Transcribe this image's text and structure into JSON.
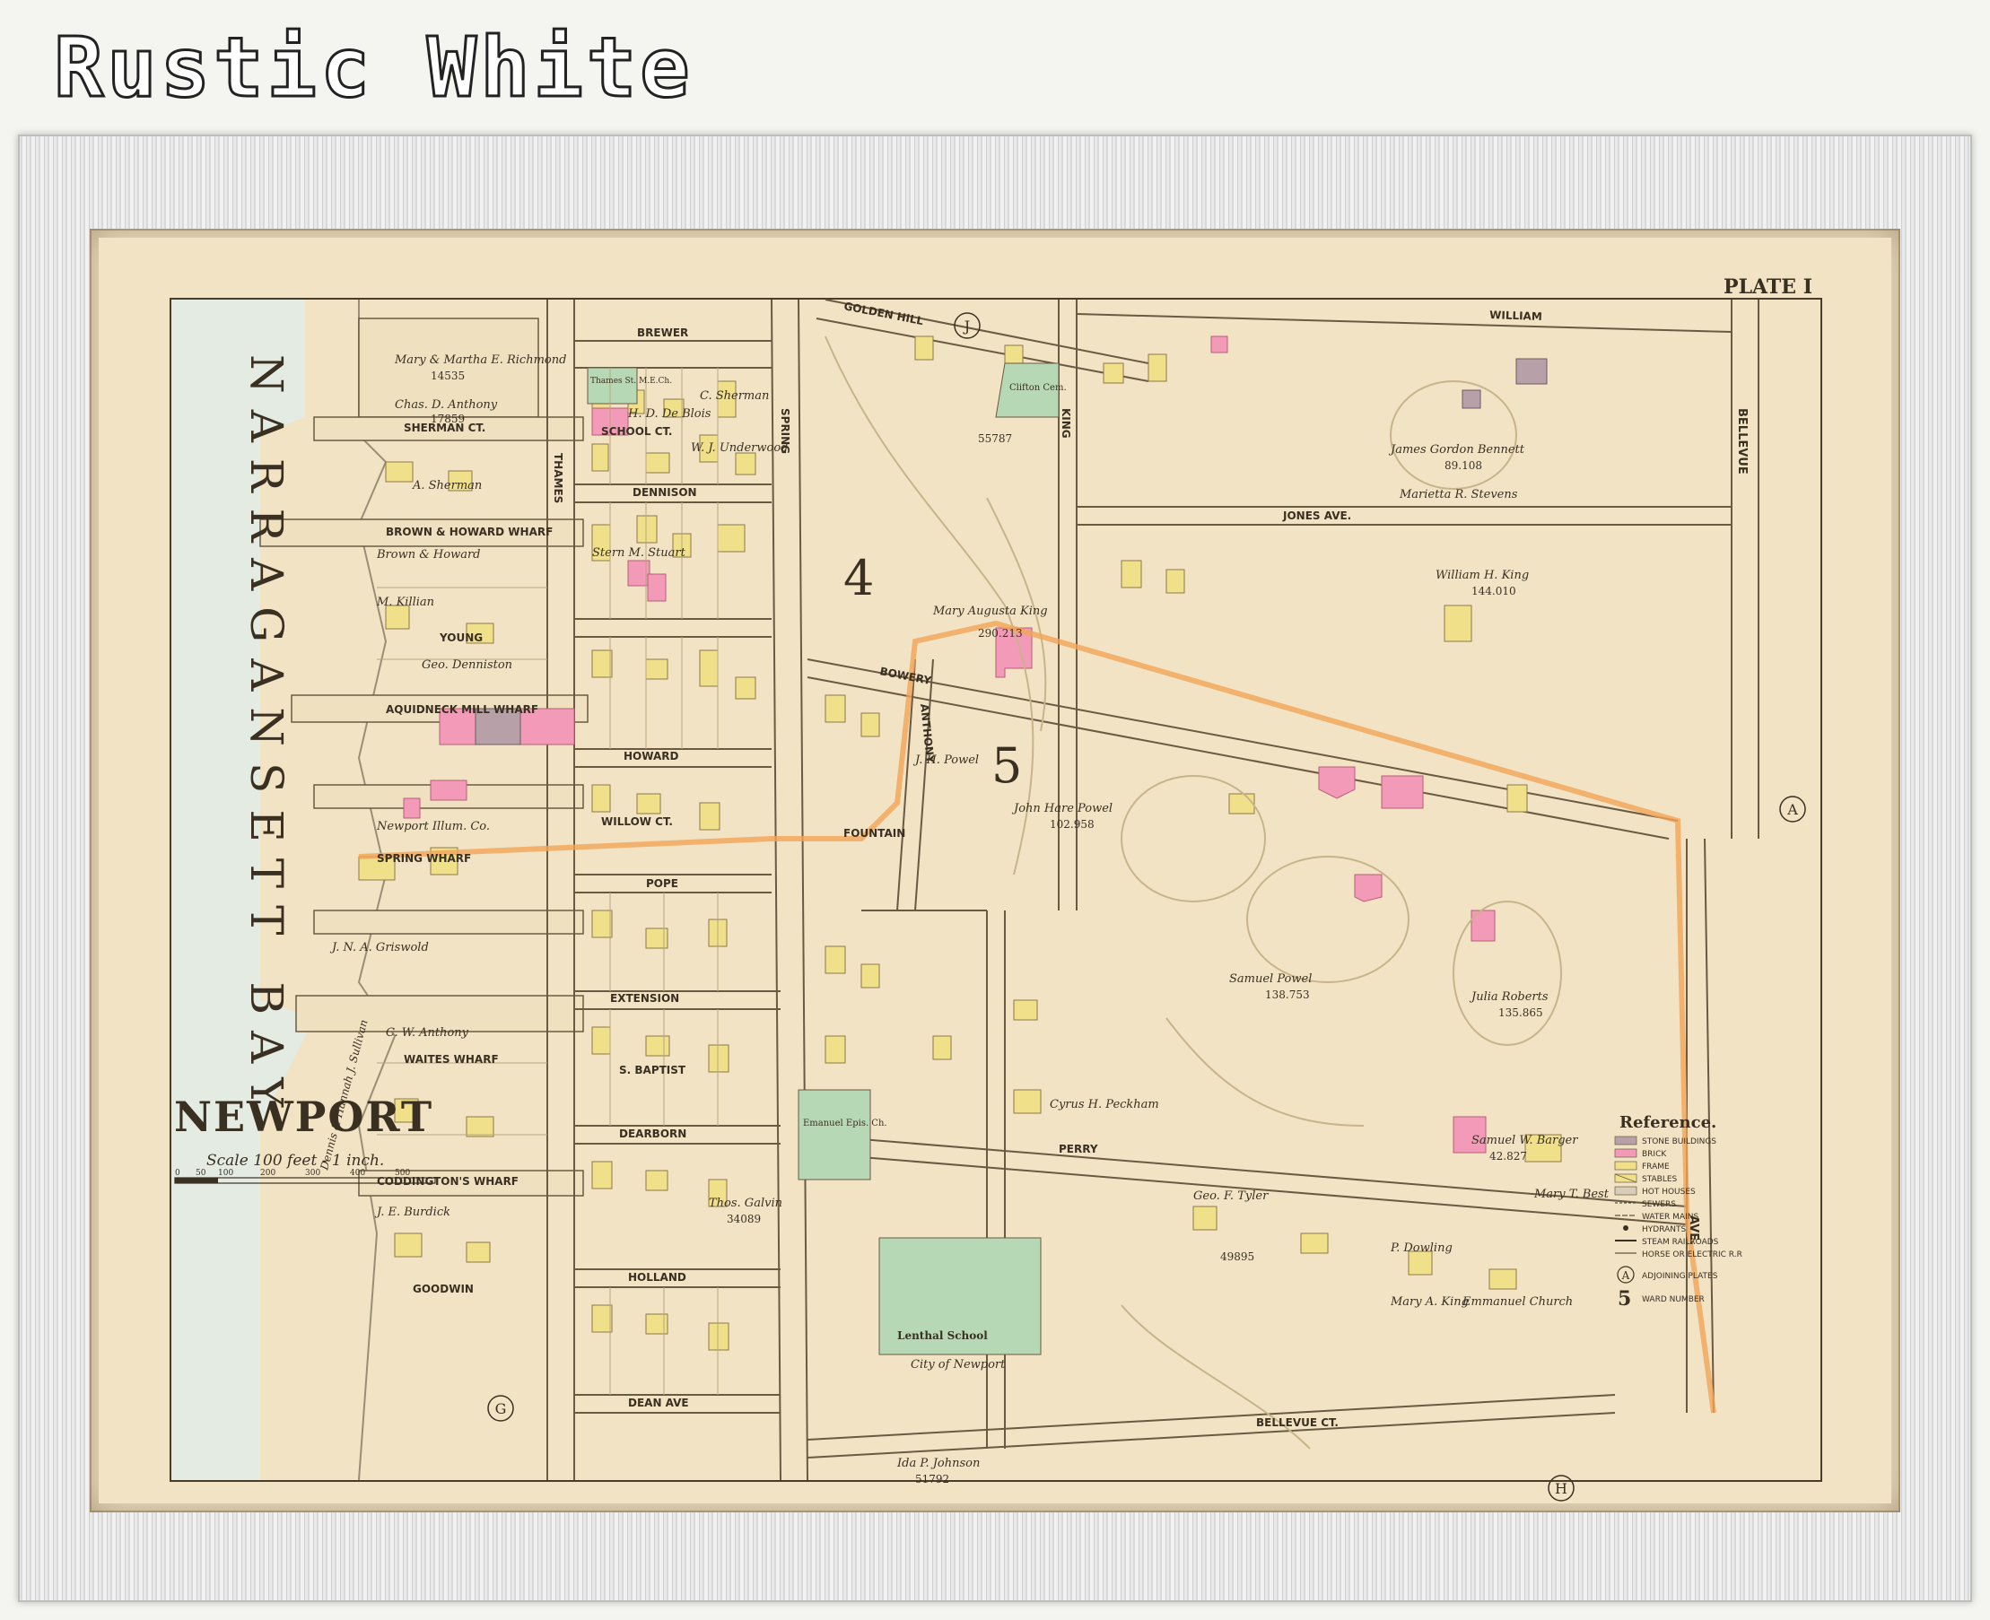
{
  "header": {
    "title": "Rustic White"
  },
  "map": {
    "plate": "PLATE I",
    "city_title": "NEWPORT",
    "scale_text": "Scale 100 feet - 1 inch.",
    "scale_ticks": [
      "0",
      "50",
      "100",
      "200",
      "300",
      "400",
      "500"
    ],
    "water_label": "NARRAGANSETT BAY",
    "ward_numbers": [
      "4",
      "5"
    ],
    "adjoining_plates": [
      "J",
      "A",
      "G",
      "H"
    ],
    "streets": {
      "brewer": "BREWER",
      "sherman_ct": "SHERMAN CT.",
      "school_ct": "SCHOOL CT.",
      "brown_howard_wharf": "BROWN & HOWARD WHARF",
      "dennison": "DENNISON",
      "young": "YOUNG",
      "howard": "HOWARD",
      "aquidneck_wharf": "AQUIDNECK MILL WHARF",
      "willow_ct": "WILLOW CT.",
      "pope": "POPE",
      "spring_wharf": "SPRING WHARF",
      "extension": "EXTENSION",
      "s_baptist": "S. BAPTIST",
      "waites_wharf": "WAITES WHARF",
      "dearborn": "DEARBORN",
      "coddingtons_wharf": "CODDINGTON'S WHARF",
      "holland": "HOLLAND",
      "goodwin": "GOODWIN",
      "dean_ave": "DEAN AVE",
      "golden_hill": "GOLDEN HILL",
      "bowery": "BOWERY",
      "fountain": "FOUNTAIN",
      "anthony": "ANTHONY",
      "perry": "PERRY",
      "bellevue_ave": "BELLEVUE",
      "bellevue_ct": "BELLEVUE CT.",
      "william": "WILLIAM",
      "jones_ave": "JONES AVE.",
      "king": "KING",
      "spring": "SPRING",
      "thames": "THAMES",
      "ave": "AVE."
    },
    "owners": [
      "Mary & Martha E. Richmond",
      "Chas. D. Anthony",
      "A. Sherman",
      "Brown & Howard",
      "M. Killian",
      "Geo. Denniston",
      "Newport Illum. Co.",
      "J. N. A. Griswold",
      "Stern M. Stuart",
      "H. D. De Blois",
      "C. Sherman",
      "W. J. Underwood",
      "C. W. Anthony",
      "Dennis & Hannah J. Sullivan",
      "J. E. Burdick",
      "Thos. Galvin",
      "Mary Augusta King",
      "James Gordon Bennett",
      "Marietta R. Stevens",
      "William H. King",
      "J. H. Powel",
      "John Hare Powel",
      "Samuel Powel",
      "Julia Roberts",
      "Samuel W. Barger",
      "Cyrus H. Peckham",
      "Geo. F. Tyler",
      "Ida P. Johnson",
      "P. Dowling",
      "Mary T. Best",
      "Emmanuel Church",
      "Mary A. King",
      "Lenthal School",
      "City of Newport",
      "Clifton Cem.",
      "Emanuel Epis. Ch.",
      "Thames St. M.E.Ch."
    ],
    "areas": [
      "290.213",
      "55787",
      "89.108",
      "144.010",
      "102.958",
      "138.753",
      "135.865",
      "42.827",
      "49895",
      "51792",
      "34089",
      "14535",
      "17859"
    ],
    "colors": {
      "paper": "#f1e3c4",
      "frame": "#e3e3e3",
      "water": "#dfe9e3",
      "brick": "#f29ab7",
      "frame_bldg": "#f0e08a",
      "stone": "#b8a0a8",
      "ward_line": "#f2a458",
      "cemetery": "#b7d8b5"
    }
  },
  "legend": {
    "title": "Reference.",
    "items": [
      {
        "label": "STONE BUILDINGS",
        "color": "#b8a0a8"
      },
      {
        "label": "BRICK",
        "color": "#f29ab7"
      },
      {
        "label": "FRAME",
        "color": "#f0e08a"
      },
      {
        "label": "STABLES",
        "color": "#f0e08a"
      },
      {
        "label": "HOT HOUSES",
        "color": "#d8cdb8"
      },
      {
        "label": "SEWERS",
        "color": ""
      },
      {
        "label": "WATER MAINS",
        "color": ""
      },
      {
        "label": "HYDRANTS",
        "color": ""
      },
      {
        "label": "STEAM RAILROADS",
        "color": ""
      },
      {
        "label": "HORSE OR ELECTRIC R.R",
        "color": ""
      }
    ],
    "adjoining": {
      "symbol": "A",
      "label": "ADJOINING PLATES"
    },
    "ward": {
      "symbol": "5",
      "label": "WARD NUMBER"
    }
  }
}
